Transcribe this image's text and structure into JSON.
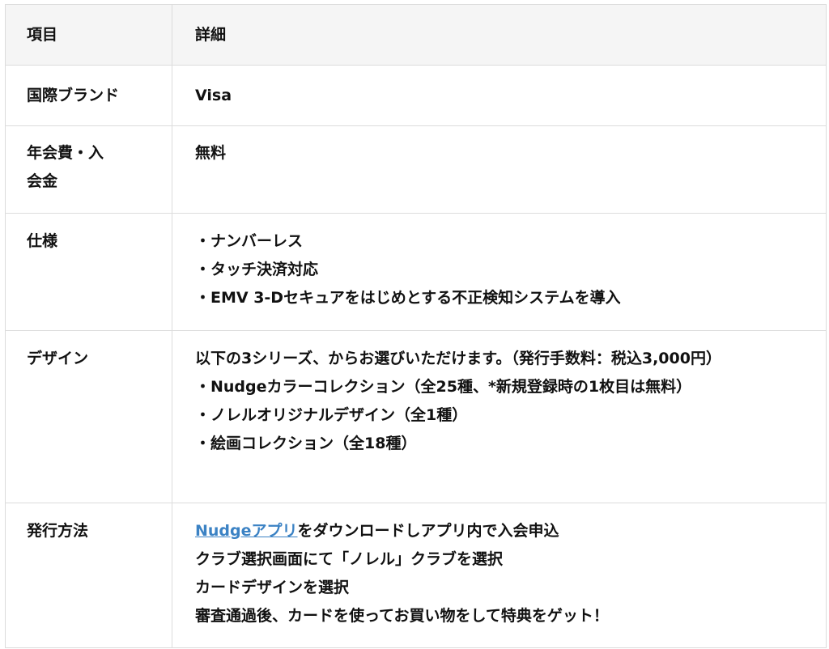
{
  "table": {
    "header": {
      "col1": "項目",
      "col2": "詳細"
    },
    "rows": {
      "brand": {
        "label": "国際ブランド",
        "value": "Visa"
      },
      "fee": {
        "label": "年会費・入会金",
        "value": "無料"
      },
      "spec": {
        "label": "仕様",
        "lines": [
          "・ナンバーレス",
          "・タッチ決済対応",
          "・EMV 3-Dセキュアをはじめとする不正検知システムを導入"
        ]
      },
      "design": {
        "label": "デザイン",
        "intro": "以下の3シリーズ、からお選びいただけます。（発行手数料：税込3,000円）",
        "lines": [
          "・Nudgeカラーコレクション（全25種、*新規登録時の1枚目は無料）",
          "・ノレルオリジナルデザイン（全1種）",
          "・絵画コレクション（全18種）"
        ]
      },
      "issue": {
        "label": "発行方法",
        "link_text": "Nudgeアプリ",
        "link_suffix": "をダウンロードしアプリ内で入会申込",
        "lines": [
          "クラブ選択画面にて「ノレル」クラブを選択",
          "カードデザインを選択",
          "審査通過後、カードを使ってお買い物をして特典をゲット！"
        ]
      }
    }
  },
  "colors": {
    "link": "#3b82c4",
    "header_bg": "#f5f5f5",
    "border": "#dcdcdc"
  }
}
